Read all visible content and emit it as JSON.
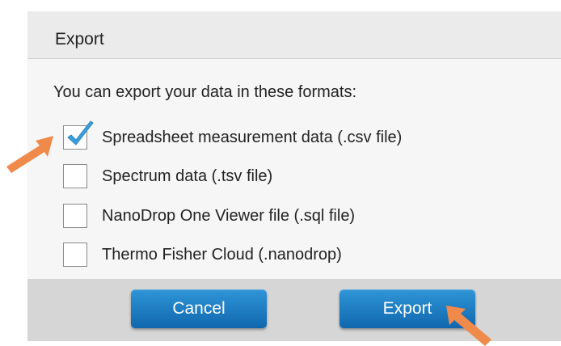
{
  "dialog": {
    "title": "Export",
    "intro": "You can export your data in these formats:",
    "options": [
      {
        "label": "Spreadsheet measurement data (.csv file)",
        "checked": true
      },
      {
        "label": "Spectrum data (.tsv file)",
        "checked": false
      },
      {
        "label": "NanoDrop One Viewer file (.sql file)",
        "checked": false
      },
      {
        "label": "Thermo Fisher Cloud (.nanodrop)",
        "checked": false
      }
    ],
    "buttons": {
      "cancel_label": "Cancel",
      "export_label": "Export"
    }
  },
  "annotations": {
    "arrow_color": "#f08a4b",
    "arrows": [
      "pointer-arrow-icon",
      "pointer-arrow-icon"
    ]
  },
  "colors": {
    "button_blue": "#1a78c2",
    "check_blue": "#3a9fe0"
  }
}
